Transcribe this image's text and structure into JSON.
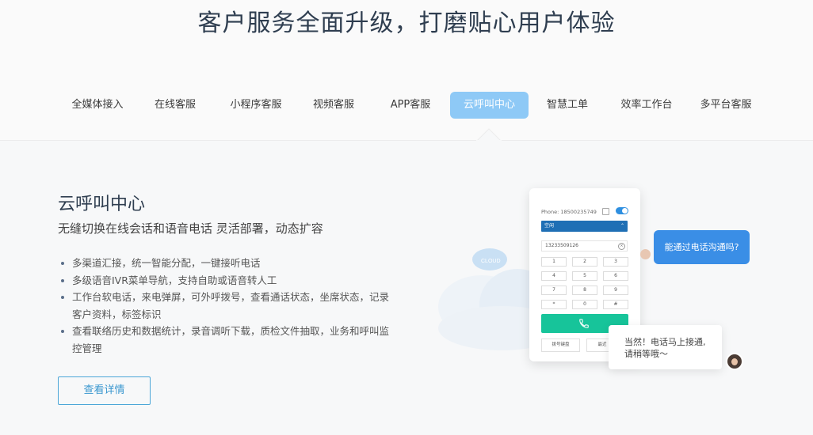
{
  "header": {
    "headline": "客户服务全面升级，打磨贴心用户体验"
  },
  "tabs": [
    {
      "label": "全媒体接入"
    },
    {
      "label": "在线客服"
    },
    {
      "label": "小程序客服"
    },
    {
      "label": "视频客服"
    },
    {
      "label": "APP客服"
    },
    {
      "label": "云呼叫中心",
      "active": true
    },
    {
      "label": "智慧工单"
    },
    {
      "label": "效率工作台"
    },
    {
      "label": "多平台客服"
    }
  ],
  "section": {
    "title": "云呼叫中心",
    "subtitle": "无缝切换在线会话和语音电话 灵活部署，动态扩容",
    "features": [
      "多渠道汇接，统一智能分配，一键接听电话",
      "多级语音IVR菜单导航，支持自助或语音转人工",
      "工作台软电话，来电弹屏，可外呼拨号，查看通话状态，坐席状态，记录客户资料，标签标识",
      "查看联络历史和数据统计，录音调听下载，质检文件抽取，业务和呼叫监控管理"
    ],
    "detail_button": "查看详情"
  },
  "illustration": {
    "cloud_label": "CLOUD",
    "phone": {
      "label": "Phone: 18500235749",
      "status": "空闲",
      "number": "13233509126",
      "keys": [
        "1",
        "2",
        "3",
        "4",
        "5",
        "6",
        "7",
        "8",
        "9",
        "*",
        "0",
        "#"
      ],
      "bottom_left": "拨号键盘",
      "bottom_right": "最近"
    },
    "bubble_right": "能通过电话沟通吗?",
    "bubble_left_line1": "当然！电话马上接通,",
    "bubble_left_line2": "请稍等哦～"
  },
  "colors": {
    "active_tab": "#8ec9f6",
    "call_green": "#17c49a",
    "bubble_blue": "#3a8ee6",
    "link_blue": "#3a97cf"
  }
}
